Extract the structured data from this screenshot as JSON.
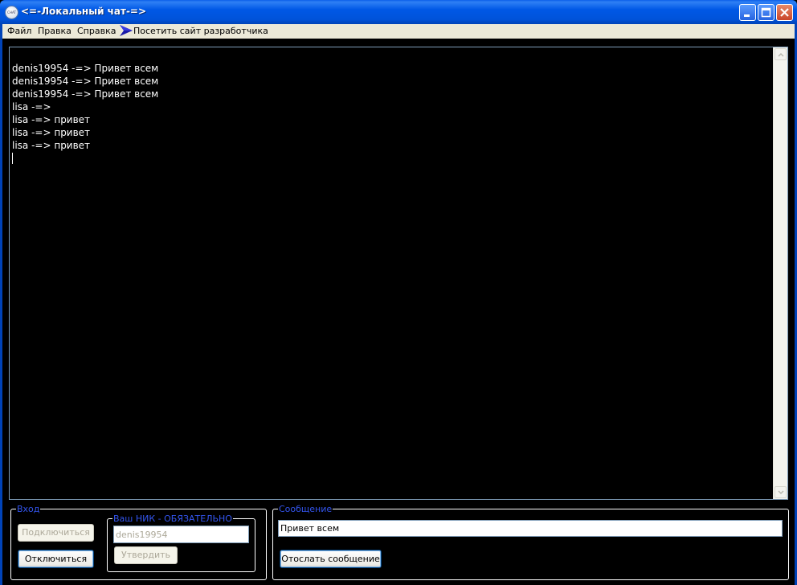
{
  "window": {
    "title": "<=-Локальный чат-=>",
    "icon": "chat-app-icon",
    "icon_text": "CHAT",
    "controls": [
      "minimize",
      "maximize",
      "close"
    ]
  },
  "menu": {
    "items": [
      "Файл",
      "Правка",
      "Справка"
    ],
    "site_link": "Посетить сайт разработчика",
    "site_icon": "arrow-icon"
  },
  "chat": {
    "lines": [
      "denis19954 -=> Привет всем",
      "denis19954 -=> Привет всем",
      "denis19954 -=> Привет всем",
      "lisa -=> ",
      "lisa -=> привет",
      "lisa -=> привет",
      "lisa -=> привет"
    ]
  },
  "login_group": {
    "title": "Вход",
    "connect_label": "Подключиться",
    "disconnect_label": "Отключиться"
  },
  "nick_group": {
    "title": "Ваш НИК - ОБЯЗАТЕЛЬНО",
    "nick_value": "denis19954",
    "confirm_label": "Утвердить"
  },
  "message_group": {
    "title": "Сообщение",
    "message_value": "Привет всем",
    "send_label": "Отослать сообщение"
  },
  "colors": {
    "titlebar": "#0058e6",
    "group_label": "#3355ee",
    "background": "#000000",
    "text": "#ffffff"
  }
}
